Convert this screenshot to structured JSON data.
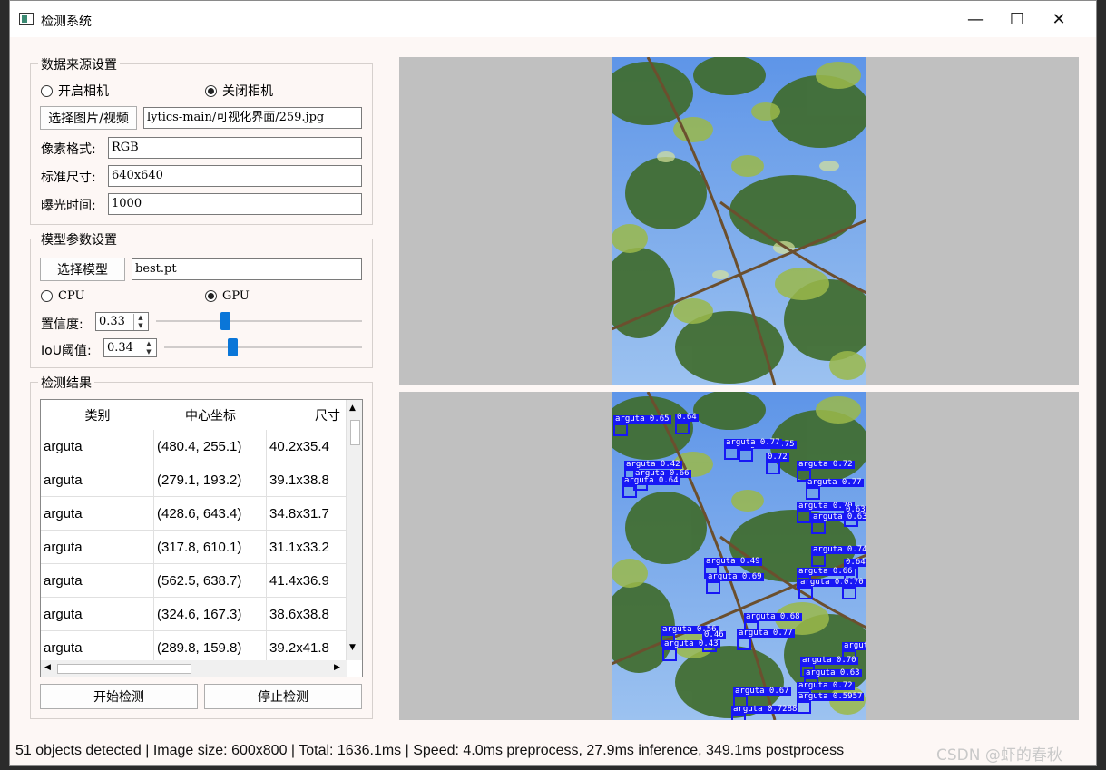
{
  "window": {
    "title": "检测系统",
    "minimize": "—",
    "maximize": "☐",
    "close": "✕"
  },
  "source_group": {
    "title": "数据来源设置",
    "open_camera": "开启相机",
    "close_camera": "关闭相机",
    "select_button": "选择图片/视频",
    "path_value": "lytics-main/可视化界面/259.jpg",
    "pixel_format_label": "像素格式:",
    "pixel_format_value": "RGB",
    "size_label": "标准尺寸:",
    "size_value": "640x640",
    "exposure_label": "曝光时间:",
    "exposure_value": "1000"
  },
  "model_group": {
    "title": "模型参数设置",
    "select_button": "选择模型",
    "model_value": "best.pt",
    "cpu": "CPU",
    "gpu": "GPU",
    "conf_label": "置信度:",
    "conf_value": "0.33",
    "iou_label": "IoU阈值:",
    "iou_value": "0.34"
  },
  "results_group": {
    "title": "检测结果",
    "columns": [
      "类别",
      "中心坐标",
      "尺寸"
    ],
    "rows": [
      [
        "arguta",
        "(480.4, 255.1)",
        "40.2x35.4"
      ],
      [
        "arguta",
        "(279.1, 193.2)",
        "39.1x38.8"
      ],
      [
        "arguta",
        "(428.6, 643.4)",
        "34.8x31.7"
      ],
      [
        "arguta",
        "(317.8, 610.1)",
        "31.1x33.2"
      ],
      [
        "arguta",
        "(562.5, 638.7)",
        "41.4x36.9"
      ],
      [
        "arguta",
        "(324.6, 167.3)",
        "38.6x38.8"
      ],
      [
        "arguta",
        "(289.8, 159.8)",
        "39.2x41.8"
      ]
    ],
    "start_button": "开始检测",
    "stop_button": "停止检测"
  },
  "detections": [
    "arguta 0.65",
    "0.64",
    "arguta 0.75",
    "arguta 0.77",
    "0.72",
    "arguta 0.42",
    "arguta 0.66",
    "arguta 0.64",
    "arguta 0.72",
    "arguta 0.77",
    "arguta 0.70",
    "0.63",
    "arguta 0.63",
    "arguta 0.74",
    "arguta 0.49",
    "0.64",
    "arguta 0.66",
    "arguta 0.69",
    "arguta 0.72",
    "0.70",
    "arguta 0.68",
    "arguta 0.56",
    "0.46",
    "arguta 0.43",
    "arguta 0.77",
    "arguta 0.75",
    "arguta 0.70",
    "arguta 0.63",
    "arguta 0.72",
    "arguta 0.67",
    "arguta 0.5957",
    "arguta 0.7288"
  ],
  "status": "51 objects detected | Image size: 600x800 | Total: 1636.1ms | Speed: 4.0ms preprocess, 27.9ms inference, 349.1ms postprocess",
  "watermark": "CSDN @虾的春秋"
}
